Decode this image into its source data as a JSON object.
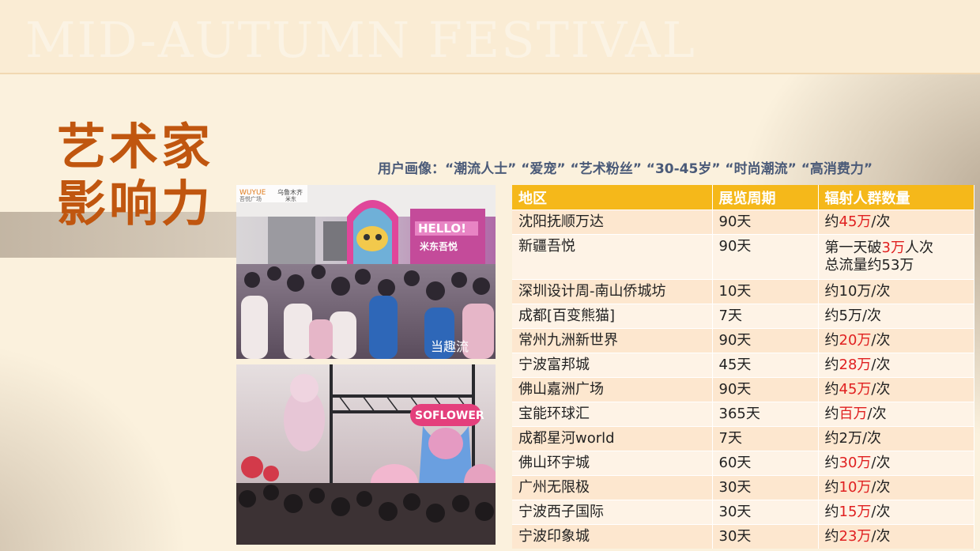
{
  "header": {
    "banner_text": "MID-AUTUMN FESTIVAL"
  },
  "title": {
    "line1": "艺术家",
    "line2": "影响力"
  },
  "persona": {
    "text": "用户画像：“潮流人士” “爱宠” “艺术粉丝” “30-45岁” “时尚潮流” “高消费力”"
  },
  "photos": {
    "top": {
      "brand_logo": "WUYUE",
      "brand_sub": "吾悦广场",
      "mall_name": "乌鲁木齐",
      "mall_name2": "米东",
      "sign": "HELLO!",
      "sign2": "米东吾悦",
      "caption": "当趣流"
    },
    "bottom": {
      "banner": "SOFLOWER"
    }
  },
  "table": {
    "headers": [
      "地区",
      "展览周期",
      "辐射人群数量"
    ],
    "rows": [
      {
        "region": "沈阳抚顺万达",
        "period": "90天",
        "pre": "约",
        "hl": "45万",
        "post": "/次"
      },
      {
        "region": "新疆吾悦",
        "period": "90天",
        "pre": "第一天破",
        "hl": "3万",
        "post": "人次",
        "line2": "总流量约53万"
      },
      {
        "region": "深圳设计周-南山侨城坊",
        "period": "10天",
        "pre": "约10万/次",
        "hl": "",
        "post": ""
      },
      {
        "region": "成都[百变熊猫]",
        "period": "7天",
        "pre": "约5万/次",
        "hl": "",
        "post": ""
      },
      {
        "region": "常州九洲新世界",
        "period": "90天",
        "pre": "约",
        "hl": "20万",
        "post": "/次"
      },
      {
        "region": "宁波富邦城",
        "period": "45天",
        "pre": "约",
        "hl": "28万",
        "post": "/次"
      },
      {
        "region": "佛山嘉洲广场",
        "period": "90天",
        "pre": "约",
        "hl": "45万",
        "post": "/次"
      },
      {
        "region": "宝能环球汇",
        "period": "365天",
        "pre": "约",
        "hl": "百万",
        "post": "/次"
      },
      {
        "region": "成都星河world",
        "period": "7天",
        "pre": "约2万/次",
        "hl": "",
        "post": ""
      },
      {
        "region": "佛山环宇城",
        "period": "60天",
        "pre": "约",
        "hl": "30万",
        "post": "/次"
      },
      {
        "region": "广州无限极",
        "period": "30天",
        "pre": "约",
        "hl": "10万",
        "post": "/次"
      },
      {
        "region": "宁波西子国际",
        "period": "30天",
        "pre": "约",
        "hl": "15万",
        "post": "/次"
      },
      {
        "region": "宁波印象城",
        "period": "30天",
        "pre": "约",
        "hl": "23万",
        "post": "/次"
      }
    ]
  },
  "colors": {
    "accent": "#c0560f",
    "table_header": "#f5b81a",
    "highlight": "#e02020",
    "persona_text": "#4a5a78"
  }
}
